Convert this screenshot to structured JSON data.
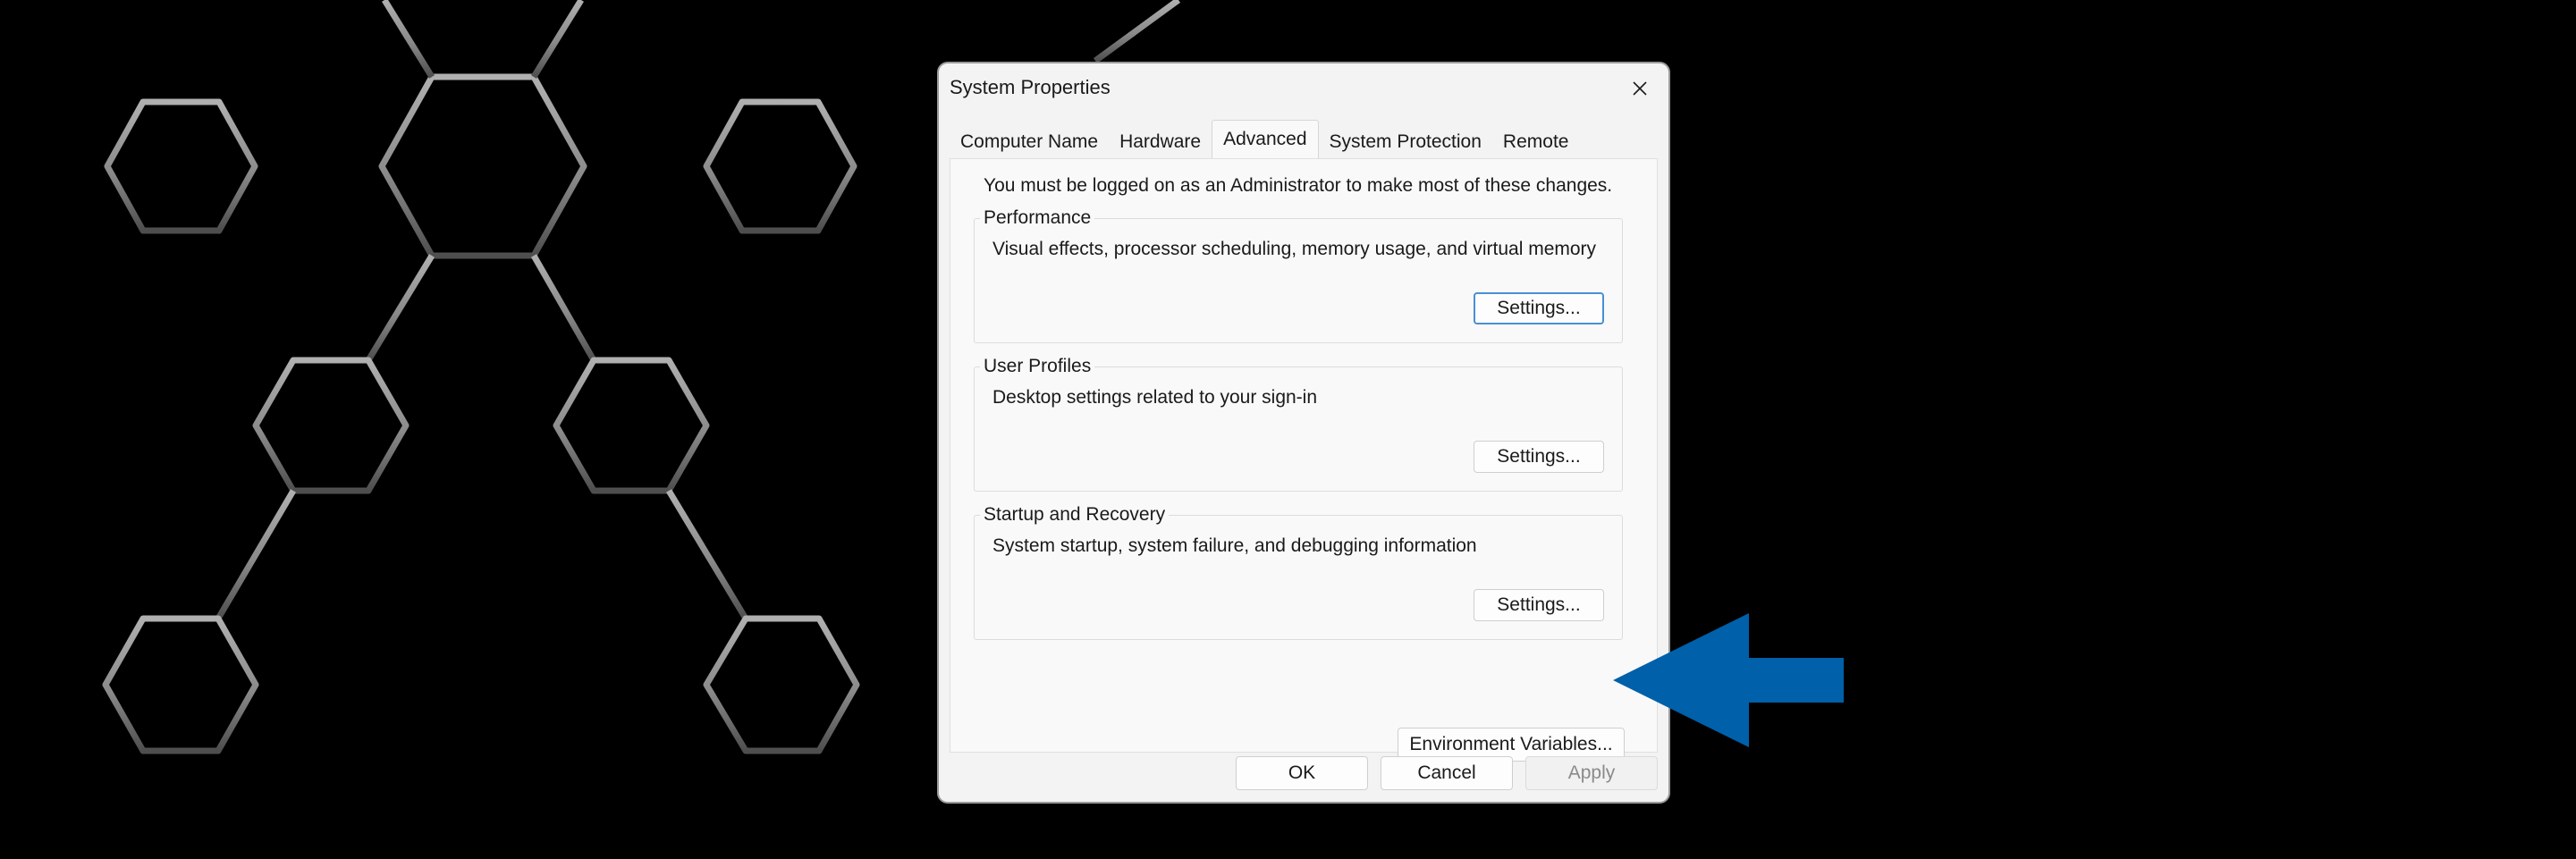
{
  "dialog": {
    "title": "System Properties",
    "tabs": [
      {
        "label": "Computer Name",
        "active": false
      },
      {
        "label": "Hardware",
        "active": false
      },
      {
        "label": "Advanced",
        "active": true
      },
      {
        "label": "System Protection",
        "active": false
      },
      {
        "label": "Remote",
        "active": false
      }
    ],
    "admin_note": "You must be logged on as an Administrator to make most of these changes.",
    "groups": [
      {
        "legend": "Performance",
        "description": "Visual effects, processor scheduling, memory usage, and virtual memory",
        "button": "Settings..."
      },
      {
        "legend": "User Profiles",
        "description": "Desktop settings related to your sign-in",
        "button": "Settings..."
      },
      {
        "legend": "Startup and Recovery",
        "description": "System startup, system failure, and debugging information",
        "button": "Settings..."
      }
    ],
    "env_button": "Environment Variables...",
    "footer": {
      "ok": "OK",
      "cancel": "Cancel",
      "apply": "Apply"
    }
  },
  "icons": {
    "close": "close-icon",
    "pointer": "arrow-left-icon"
  },
  "colors": {
    "background": "#000000",
    "hexagon_light": "#a8a8a8",
    "hexagon_dark": "#5a5a5a",
    "pointer_arrow": "#0060aa",
    "focus_border": "#4a8fd6"
  }
}
